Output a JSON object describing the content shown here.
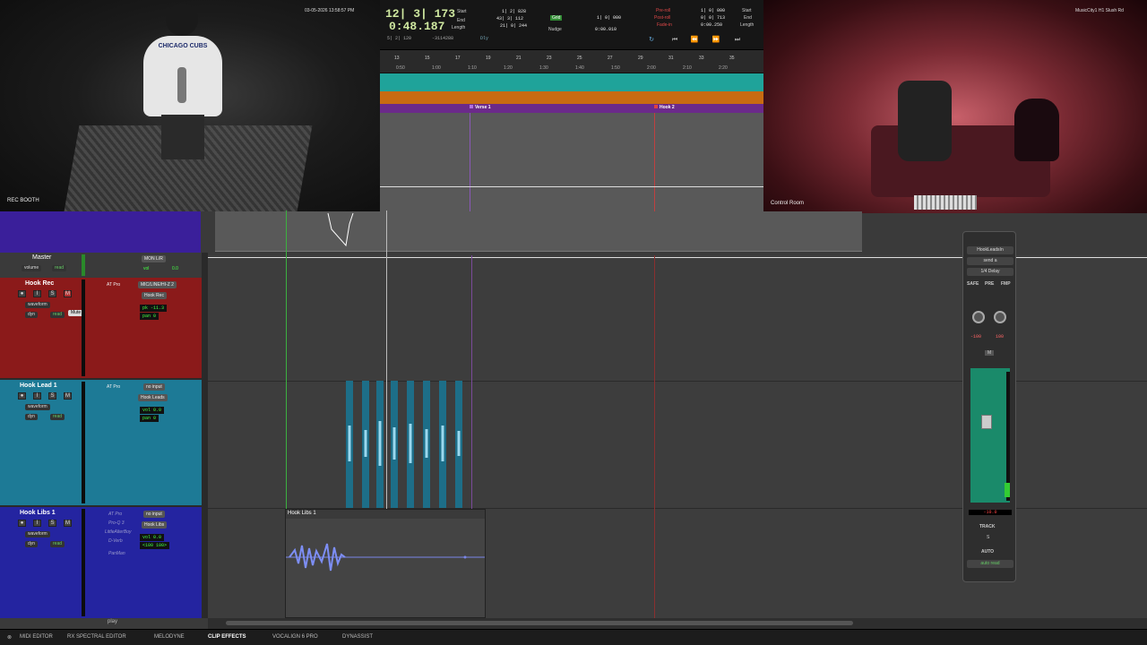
{
  "cams": {
    "booth": {
      "label": "REC BOOTH",
      "timestamp": "03-05-2026 13:58:57 PM",
      "shirt_text": "CHICAGO CUBS"
    },
    "control": {
      "label": "Control Room",
      "stamp": "MusicCity1 H1 Slush Rd"
    }
  },
  "counter": {
    "bars": "12| 3| 173",
    "time": "0:48.187",
    "start_lbl": "Start",
    "end_lbl": "End",
    "length_lbl": "Length",
    "start_val": "1| 2| 828",
    "end_val": "43| 3| 112",
    "length_val": "21| 0| 244",
    "sub_info": "5| 2| 120",
    "sub_info2": "-3114288",
    "dly_lbl": "Dly",
    "grid_lbl": "Grid",
    "grid_val": "1| 0| 000",
    "nudge_lbl": "Nudge",
    "nudge_val": "0:00.010",
    "preroll_lbl": "Pre-roll",
    "postroll_lbl": "Post-roll",
    "fadein_lbl": "Fade-in",
    "preroll_val": "1| 0| 000",
    "postroll_val": "0| 0| 713",
    "fadein_val": "0:00.250",
    "right_start": "Start",
    "right_end": "End",
    "right_length": "Length"
  },
  "ruler": {
    "bars": [
      "13",
      "15",
      "17",
      "19",
      "21",
      "23",
      "25",
      "27",
      "29",
      "31",
      "33",
      "35"
    ],
    "times": [
      "0:50",
      "1:00",
      "1:10",
      "1:20",
      "1:30",
      "1:40",
      "1:50",
      "2:00",
      "2:10",
      "2:20"
    ]
  },
  "markers": [
    {
      "label": "Verse 1",
      "color": "#9b4fd0"
    },
    {
      "label": "Hook 2",
      "color": "#e04040"
    }
  ],
  "master": {
    "name": "Master",
    "view": "volume",
    "mode": "read",
    "io": "MON L/R",
    "vol_lbl": "vol",
    "vol": "0.0"
  },
  "tracks": [
    {
      "name": "Hook Rec",
      "view": "waveform",
      "dyn": "dyn",
      "mode": "read",
      "insert": "AT Pro",
      "input": "MIC/LINE/HI-Z 2",
      "output": "Hook Rec",
      "pk_lbl": "pk",
      "pk": "-11.3",
      "pan_lbl": "pan",
      "pan": "0",
      "tooltip": "Mute"
    },
    {
      "name": "Hook Lead 1",
      "view": "waveform",
      "dyn": "dyn",
      "mode": "read",
      "insert": "AT Pro",
      "input": "no input",
      "output": "Hook Leads",
      "vol_lbl": "vol",
      "vol": "0.0",
      "pan_lbl": "pan",
      "pan": "0"
    },
    {
      "name": "Hook Libs 1",
      "view": "waveform",
      "dyn": "dyn",
      "mode": "read",
      "inserts": [
        "AT Pro",
        "Pro-Q 3",
        "LittleAlterBoy",
        "D-Verb",
        "PanMan"
      ],
      "input": "no input",
      "output": "Hook Libs",
      "vol_lbl": "vol",
      "vol": "0.0",
      "pan_l": "<100",
      "pan_r": "100>",
      "clip_name": "Hook Libs 1"
    }
  ],
  "play_label": "play",
  "mixer": {
    "name": "HookLeadsIn",
    "send": "send a",
    "insert": "1/4 Delay",
    "safe": "SAFE",
    "pre": "PRE",
    "fmp": "FMP",
    "pan_l": "-100",
    "pan_r": "100",
    "mute": "M",
    "vol": "-10.0",
    "track_lbl": "TRACK",
    "s_lbl": "S",
    "auto_lbl": "AUTO",
    "auto_mode": "auto read"
  },
  "bottom_tabs": [
    "MIDI EDITOR",
    "RX SPECTRAL EDITOR",
    "MELODYNE",
    "CLIP EFFECTS",
    "VOCALIGN 6 PRO",
    "DYNASSIST"
  ],
  "colors": {
    "hook_rec": "#8b1a1a",
    "hook_lead": "#1d7a96",
    "hook_libs": "#2424a0",
    "tempo": "#1fa39a",
    "key": "#c86b12",
    "markers": "#6b2a8a"
  }
}
